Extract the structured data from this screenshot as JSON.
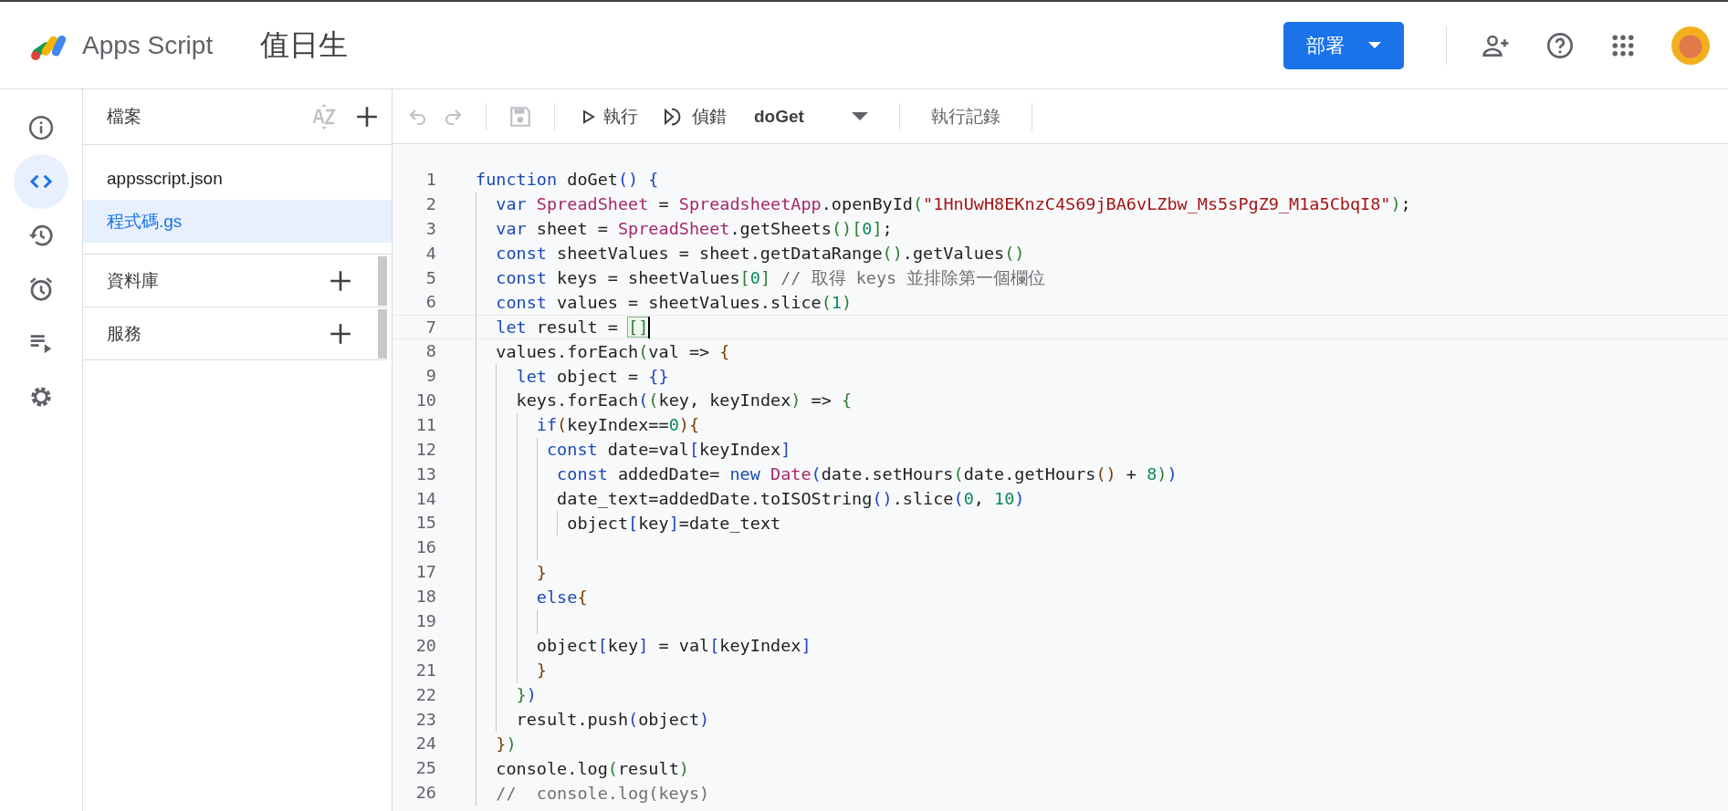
{
  "header": {
    "app_name": "Apps Script",
    "project_title": "值日生",
    "deploy_button": "部署"
  },
  "rail": [
    {
      "kind": "info",
      "selected": false
    },
    {
      "kind": "code",
      "selected": true
    },
    {
      "kind": "history",
      "selected": false
    },
    {
      "kind": "alarm",
      "selected": false
    },
    {
      "kind": "executions",
      "selected": false
    },
    {
      "kind": "settings",
      "selected": false
    }
  ],
  "files": {
    "title": "檔案",
    "items": [
      {
        "name": "appsscript.json",
        "selected": false
      },
      {
        "name": "程式碼.gs",
        "selected": true
      }
    ]
  },
  "sections": [
    {
      "title": "資料庫"
    },
    {
      "title": "服務"
    }
  ],
  "toolbar": {
    "run": "執行",
    "debug": "偵錯",
    "function": "doGet",
    "log": "執行記錄"
  },
  "code": [
    {
      "number": "1",
      "current": false,
      "tokens": [
        {
          "kind": "kw",
          "text": "function"
        },
        {
          "kind": "p",
          "text": " doGet"
        },
        {
          "kind": "b1",
          "text": "()"
        },
        {
          "kind": "b1",
          "text": " {"
        }
      ]
    },
    {
      "number": "2",
      "current": false,
      "tokens": [
        {
          "kind": "kw",
          "text": "  var"
        },
        {
          "kind": "type",
          "text": " SpreadSheet"
        },
        {
          "kind": "p",
          "text": " = "
        },
        {
          "kind": "type",
          "text": "SpreadsheetApp"
        },
        {
          "kind": "p",
          "text": ".openById"
        },
        {
          "kind": "b2",
          "text": "("
        },
        {
          "kind": "str",
          "text": "\"1HnUwH8EKnzC4S69jBA6vLZbw_Ms5sPgZ9_M1a5CbqI8\""
        },
        {
          "kind": "b2",
          "text": ")"
        },
        {
          "kind": "p",
          "text": ";"
        }
      ]
    },
    {
      "number": "3",
      "current": false,
      "tokens": [
        {
          "kind": "kw",
          "text": "  var"
        },
        {
          "kind": "p",
          "text": " sheet = "
        },
        {
          "kind": "type",
          "text": "SpreadSheet"
        },
        {
          "kind": "p",
          "text": ".getSheets"
        },
        {
          "kind": "b2",
          "text": "()["
        },
        {
          "kind": "num",
          "text": "0"
        },
        {
          "kind": "b2",
          "text": "]"
        },
        {
          "kind": "p",
          "text": ";"
        }
      ]
    },
    {
      "number": "4",
      "current": false,
      "tokens": [
        {
          "kind": "kw",
          "text": "  const"
        },
        {
          "kind": "p",
          "text": " sheetValues = sheet.getDataRange"
        },
        {
          "kind": "b2",
          "text": "()"
        },
        {
          "kind": "p",
          "text": ".getValues"
        },
        {
          "kind": "b2",
          "text": "()"
        }
      ]
    },
    {
      "number": "5",
      "current": false,
      "tokens": [
        {
          "kind": "kw",
          "text": "  const"
        },
        {
          "kind": "p",
          "text": " keys = sheetValues"
        },
        {
          "kind": "b2",
          "text": "["
        },
        {
          "kind": "num",
          "text": "0"
        },
        {
          "kind": "b2",
          "text": "]"
        },
        {
          "kind": "cmt",
          "text": " // 取得 keys 並排除第一個欄位"
        }
      ]
    },
    {
      "number": "6",
      "current": false,
      "tokens": [
        {
          "kind": "kw",
          "text": "  const"
        },
        {
          "kind": "p",
          "text": " values = sheetValues.slice"
        },
        {
          "kind": "b2",
          "text": "("
        },
        {
          "kind": "num",
          "text": "1"
        },
        {
          "kind": "b2",
          "text": ")"
        }
      ]
    },
    {
      "number": "7",
      "current": true,
      "tokens": [
        {
          "kind": "kw",
          "text": "  let"
        },
        {
          "kind": "p",
          "text": " result = "
        },
        {
          "kind": "match",
          "text": "[]"
        }
      ]
    },
    {
      "number": "8",
      "current": false,
      "tokens": [
        {
          "kind": "p",
          "text": "  values.forEach"
        },
        {
          "kind": "b2",
          "text": "("
        },
        {
          "kind": "p",
          "text": "val => "
        },
        {
          "kind": "b3",
          "text": "{"
        }
      ]
    },
    {
      "number": "9",
      "current": false,
      "tokens": [
        {
          "kind": "kw",
          "text": "    let"
        },
        {
          "kind": "p",
          "text": " object = "
        },
        {
          "kind": "b1",
          "text": "{}"
        }
      ]
    },
    {
      "number": "10",
      "current": false,
      "tokens": [
        {
          "kind": "p",
          "text": "    keys.forEach"
        },
        {
          "kind": "b1",
          "text": "("
        },
        {
          "kind": "b2",
          "text": "("
        },
        {
          "kind": "p",
          "text": "key, keyIndex"
        },
        {
          "kind": "b2",
          "text": ")"
        },
        {
          "kind": "p",
          "text": " => "
        },
        {
          "kind": "b2",
          "text": "{"
        }
      ]
    },
    {
      "number": "11",
      "current": false,
      "tokens": [
        {
          "kind": "kw",
          "text": "      if"
        },
        {
          "kind": "b3",
          "text": "("
        },
        {
          "kind": "p",
          "text": "keyIndex=="
        },
        {
          "kind": "num",
          "text": "0"
        },
        {
          "kind": "b3",
          "text": "){"
        }
      ]
    },
    {
      "number": "12",
      "current": false,
      "tokens": [
        {
          "kind": "kw",
          "text": "       const"
        },
        {
          "kind": "p",
          "text": " date=val"
        },
        {
          "kind": "b1",
          "text": "["
        },
        {
          "kind": "p",
          "text": "keyIndex"
        },
        {
          "kind": "b1",
          "text": "]"
        }
      ]
    },
    {
      "number": "13",
      "current": false,
      "tokens": [
        {
          "kind": "kw",
          "text": "        const"
        },
        {
          "kind": "p",
          "text": " addedDate= "
        },
        {
          "kind": "kw",
          "text": "new"
        },
        {
          "kind": "type",
          "text": " Date"
        },
        {
          "kind": "b1",
          "text": "("
        },
        {
          "kind": "p",
          "text": "date.setHours"
        },
        {
          "kind": "b2",
          "text": "("
        },
        {
          "kind": "p",
          "text": "date.getHours"
        },
        {
          "kind": "b3",
          "text": "()"
        },
        {
          "kind": "p",
          "text": " + "
        },
        {
          "kind": "num",
          "text": "8"
        },
        {
          "kind": "b2",
          "text": ")"
        },
        {
          "kind": "b1",
          "text": ")"
        }
      ]
    },
    {
      "number": "14",
      "current": false,
      "tokens": [
        {
          "kind": "p",
          "text": "        date_text=addedDate.toISOString"
        },
        {
          "kind": "b1",
          "text": "()"
        },
        {
          "kind": "p",
          "text": ".slice"
        },
        {
          "kind": "b1",
          "text": "("
        },
        {
          "kind": "num",
          "text": "0"
        },
        {
          "kind": "p",
          "text": ","
        },
        {
          "kind": "num",
          "text": " 10"
        },
        {
          "kind": "b1",
          "text": ")"
        }
      ]
    },
    {
      "number": "15",
      "current": false,
      "tokens": [
        {
          "kind": "p",
          "text": "         object"
        },
        {
          "kind": "b1",
          "text": "["
        },
        {
          "kind": "p",
          "text": "key"
        },
        {
          "kind": "b1",
          "text": "]"
        },
        {
          "kind": "p",
          "text": "=date_text"
        }
      ]
    },
    {
      "number": "16",
      "current": false
    },
    {
      "number": "17",
      "current": false,
      "tokens": [
        {
          "kind": "b3",
          "text": "      }"
        }
      ]
    },
    {
      "number": "18",
      "current": false,
      "tokens": [
        {
          "kind": "kw",
          "text": "      else"
        },
        {
          "kind": "b3",
          "text": "{"
        }
      ]
    },
    {
      "number": "19",
      "current": false
    },
    {
      "number": "20",
      "current": false,
      "tokens": [
        {
          "kind": "p",
          "text": "      object"
        },
        {
          "kind": "b1",
          "text": "["
        },
        {
          "kind": "p",
          "text": "key"
        },
        {
          "kind": "b1",
          "text": "]"
        },
        {
          "kind": "p",
          "text": " = val"
        },
        {
          "kind": "b1",
          "text": "["
        },
        {
          "kind": "p",
          "text": "keyIndex"
        },
        {
          "kind": "b1",
          "text": "]"
        }
      ]
    },
    {
      "number": "21",
      "current": false,
      "tokens": [
        {
          "kind": "b3",
          "text": "      }"
        }
      ]
    },
    {
      "number": "22",
      "current": false,
      "tokens": [
        {
          "kind": "b2",
          "text": "    }"
        },
        {
          "kind": "b1",
          "text": ")"
        }
      ]
    },
    {
      "number": "23",
      "current": false,
      "tokens": [
        {
          "kind": "p",
          "text": "    result.push"
        },
        {
          "kind": "b1",
          "text": "("
        },
        {
          "kind": "p",
          "text": "object"
        },
        {
          "kind": "b1",
          "text": ")"
        }
      ]
    },
    {
      "number": "24",
      "current": false,
      "tokens": [
        {
          "kind": "b3",
          "text": "  }"
        },
        {
          "kind": "b2",
          "text": ")"
        }
      ]
    },
    {
      "number": "25",
      "current": false,
      "tokens": [
        {
          "kind": "p",
          "text": "  console.log"
        },
        {
          "kind": "b2",
          "text": "("
        },
        {
          "kind": "p",
          "text": "result"
        },
        {
          "kind": "b2",
          "text": ")"
        }
      ]
    },
    {
      "number": "26",
      "current": false,
      "tokens": [
        {
          "kind": "cmt",
          "text": "  //  console.log(keys)"
        }
      ]
    }
  ]
}
